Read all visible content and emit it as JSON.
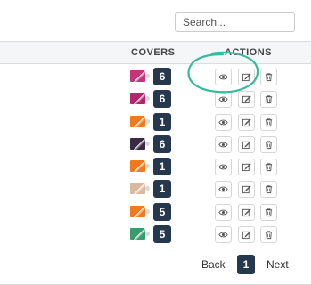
{
  "search": {
    "placeholder": "Search..."
  },
  "table": {
    "headers": {
      "covers": "COVERS",
      "actions": "ACTIONS"
    },
    "rows": [
      {
        "cover_color": "#c5337a",
        "count": "6"
      },
      {
        "cover_color": "#b3246c",
        "count": "6"
      },
      {
        "cover_color": "#f07a1c",
        "count": "1"
      },
      {
        "cover_color": "#3a2a44",
        "count": "6"
      },
      {
        "cover_color": "#f07a1c",
        "count": "1"
      },
      {
        "cover_color": "#d9b9a0",
        "count": "1"
      },
      {
        "cover_color": "#f07a1c",
        "count": "5"
      },
      {
        "cover_color": "#3a9a70",
        "count": "5"
      }
    ]
  },
  "actions": {
    "icons": [
      "eye-icon",
      "edit-icon",
      "trash-icon"
    ]
  },
  "pagination": {
    "back": "Back",
    "page": "1",
    "next": "Next"
  },
  "colors": {
    "badge": "#26384d",
    "annotation": "#3bb8a0"
  }
}
